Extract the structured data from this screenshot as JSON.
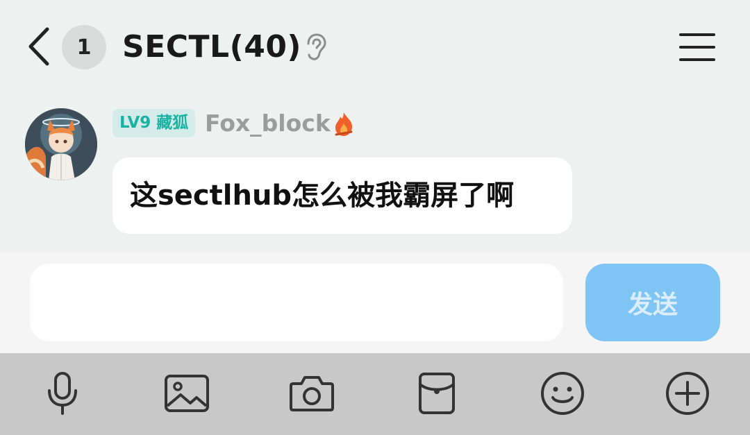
{
  "header": {
    "back_icon": "chevron-left-icon",
    "unread_count": "1",
    "title": "SECTL(40)",
    "ear_icon": "ear-icon",
    "menu_icon": "hamburger-menu-icon"
  },
  "messages": [
    {
      "level": "LV9 藏狐",
      "username": "Fox_block",
      "flair_icon": "fire-icon",
      "text": "这sectlhub怎么被我霸屏了啊"
    }
  ],
  "composer": {
    "input_value": "",
    "send_label": "发送"
  },
  "toolbar": {
    "icons": [
      "microphone-icon",
      "image-icon",
      "camera-icon",
      "red-packet-icon",
      "emoji-icon",
      "plus-icon"
    ]
  },
  "colors": {
    "background": "#edf1ef",
    "level_bg": "#d3ece9",
    "level_text": "#1ab3a3",
    "send_button": "#7ec4f5",
    "toolbar_bg": "#c8c8c8"
  }
}
